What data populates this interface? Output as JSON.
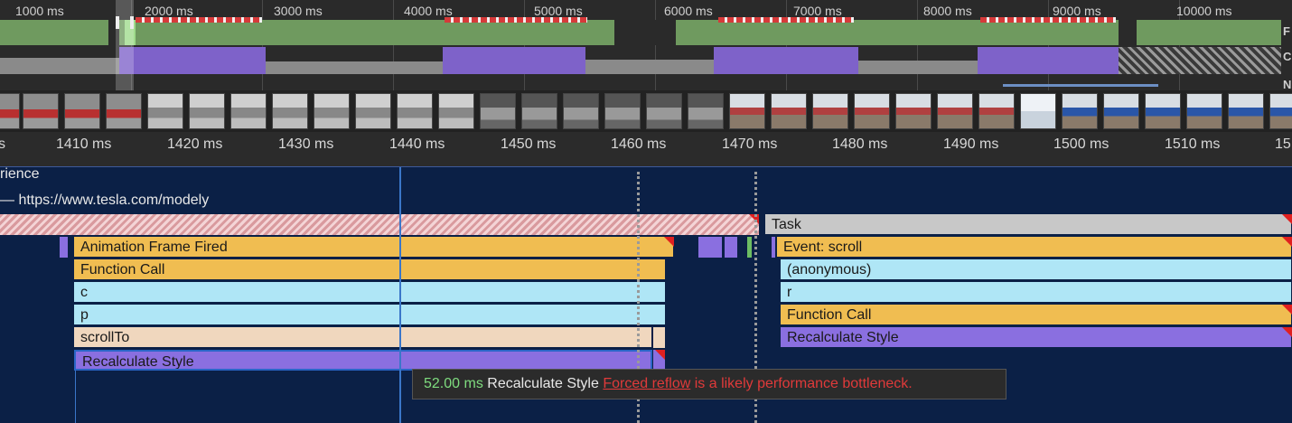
{
  "overview": {
    "labels": [
      "1000 ms",
      "2000 ms",
      "3000 ms",
      "4000 ms",
      "5000 ms",
      "6000 ms",
      "7000 ms",
      "8000 ms",
      "9000 ms",
      "10000 ms"
    ],
    "side_letters": [
      "F",
      "C",
      "N"
    ]
  },
  "ruler": {
    "ticks": [
      "s",
      "1410 ms",
      "1420 ms",
      "1430 ms",
      "1440 ms",
      "1450 ms",
      "1460 ms",
      "1470 ms",
      "1480 ms",
      "1490 ms",
      "1500 ms",
      "1510 ms",
      "15"
    ]
  },
  "tracks": {
    "experience_label": "rience",
    "main_label": "— https://www.tesla.com/modely"
  },
  "flame": {
    "task": "Task",
    "animation_frame": "Animation Frame Fired",
    "function_call": "Function Call",
    "c": "c",
    "p": "p",
    "scroll_to": "scrollTo",
    "recalc_left": "Recalculate Style",
    "event_scroll": "Event: scroll",
    "anonymous": "(anonymous)",
    "r": "r",
    "function_call_right": "Function Call",
    "recalc_right": "Recalculate Style"
  },
  "tooltip": {
    "duration": "52.00 ms",
    "name": "Recalculate Style",
    "link": "Forced reflow",
    "message": "is a likely performance bottleneck."
  },
  "colors": {
    "scripting": "#f0bd51",
    "rendering": "#8a6fe0",
    "js_frame": "#afe6f6",
    "warning": "#e02020"
  }
}
